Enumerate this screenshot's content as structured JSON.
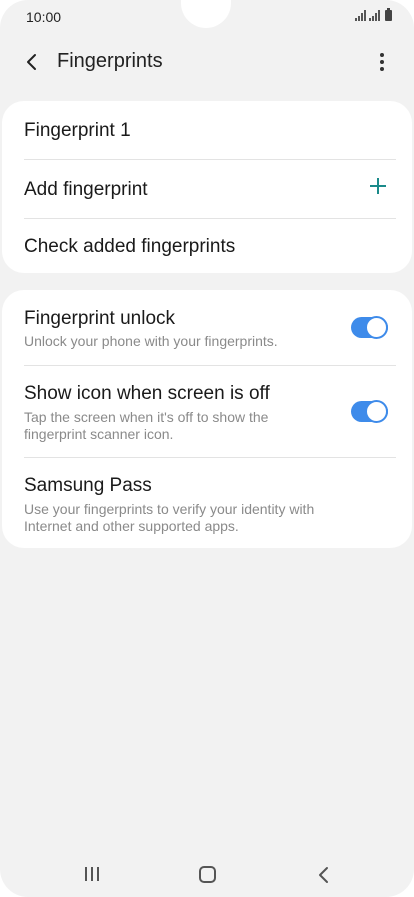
{
  "status": {
    "time": "10:00"
  },
  "header": {
    "title": "Fingerprints"
  },
  "card1": {
    "items": [
      {
        "label": "Fingerprint 1"
      },
      {
        "label": "Add fingerprint"
      },
      {
        "label": "Check added fingerprints"
      }
    ]
  },
  "card2": {
    "items": [
      {
        "label": "Fingerprint unlock",
        "subtitle": "Unlock your phone with your fingerprints.",
        "toggle_on": true
      },
      {
        "label": "Show icon when screen is off",
        "subtitle": "Tap the screen when it's off to show the fingerprint scanner icon.",
        "toggle_on": true
      },
      {
        "label": "Samsung Pass",
        "subtitle": "Use your fingerprints to verify your identity with Internet and other supported apps."
      }
    ]
  },
  "colors": {
    "accent": "#3e8bea",
    "plus": "#1a8a8a",
    "background": "#f2f2f2"
  },
  "icons": {
    "back": "back-arrow-icon",
    "more": "more-options-icon",
    "add": "plus-icon",
    "nav_recent": "recent-apps-icon",
    "nav_home": "home-icon",
    "nav_back": "nav-back-icon"
  }
}
